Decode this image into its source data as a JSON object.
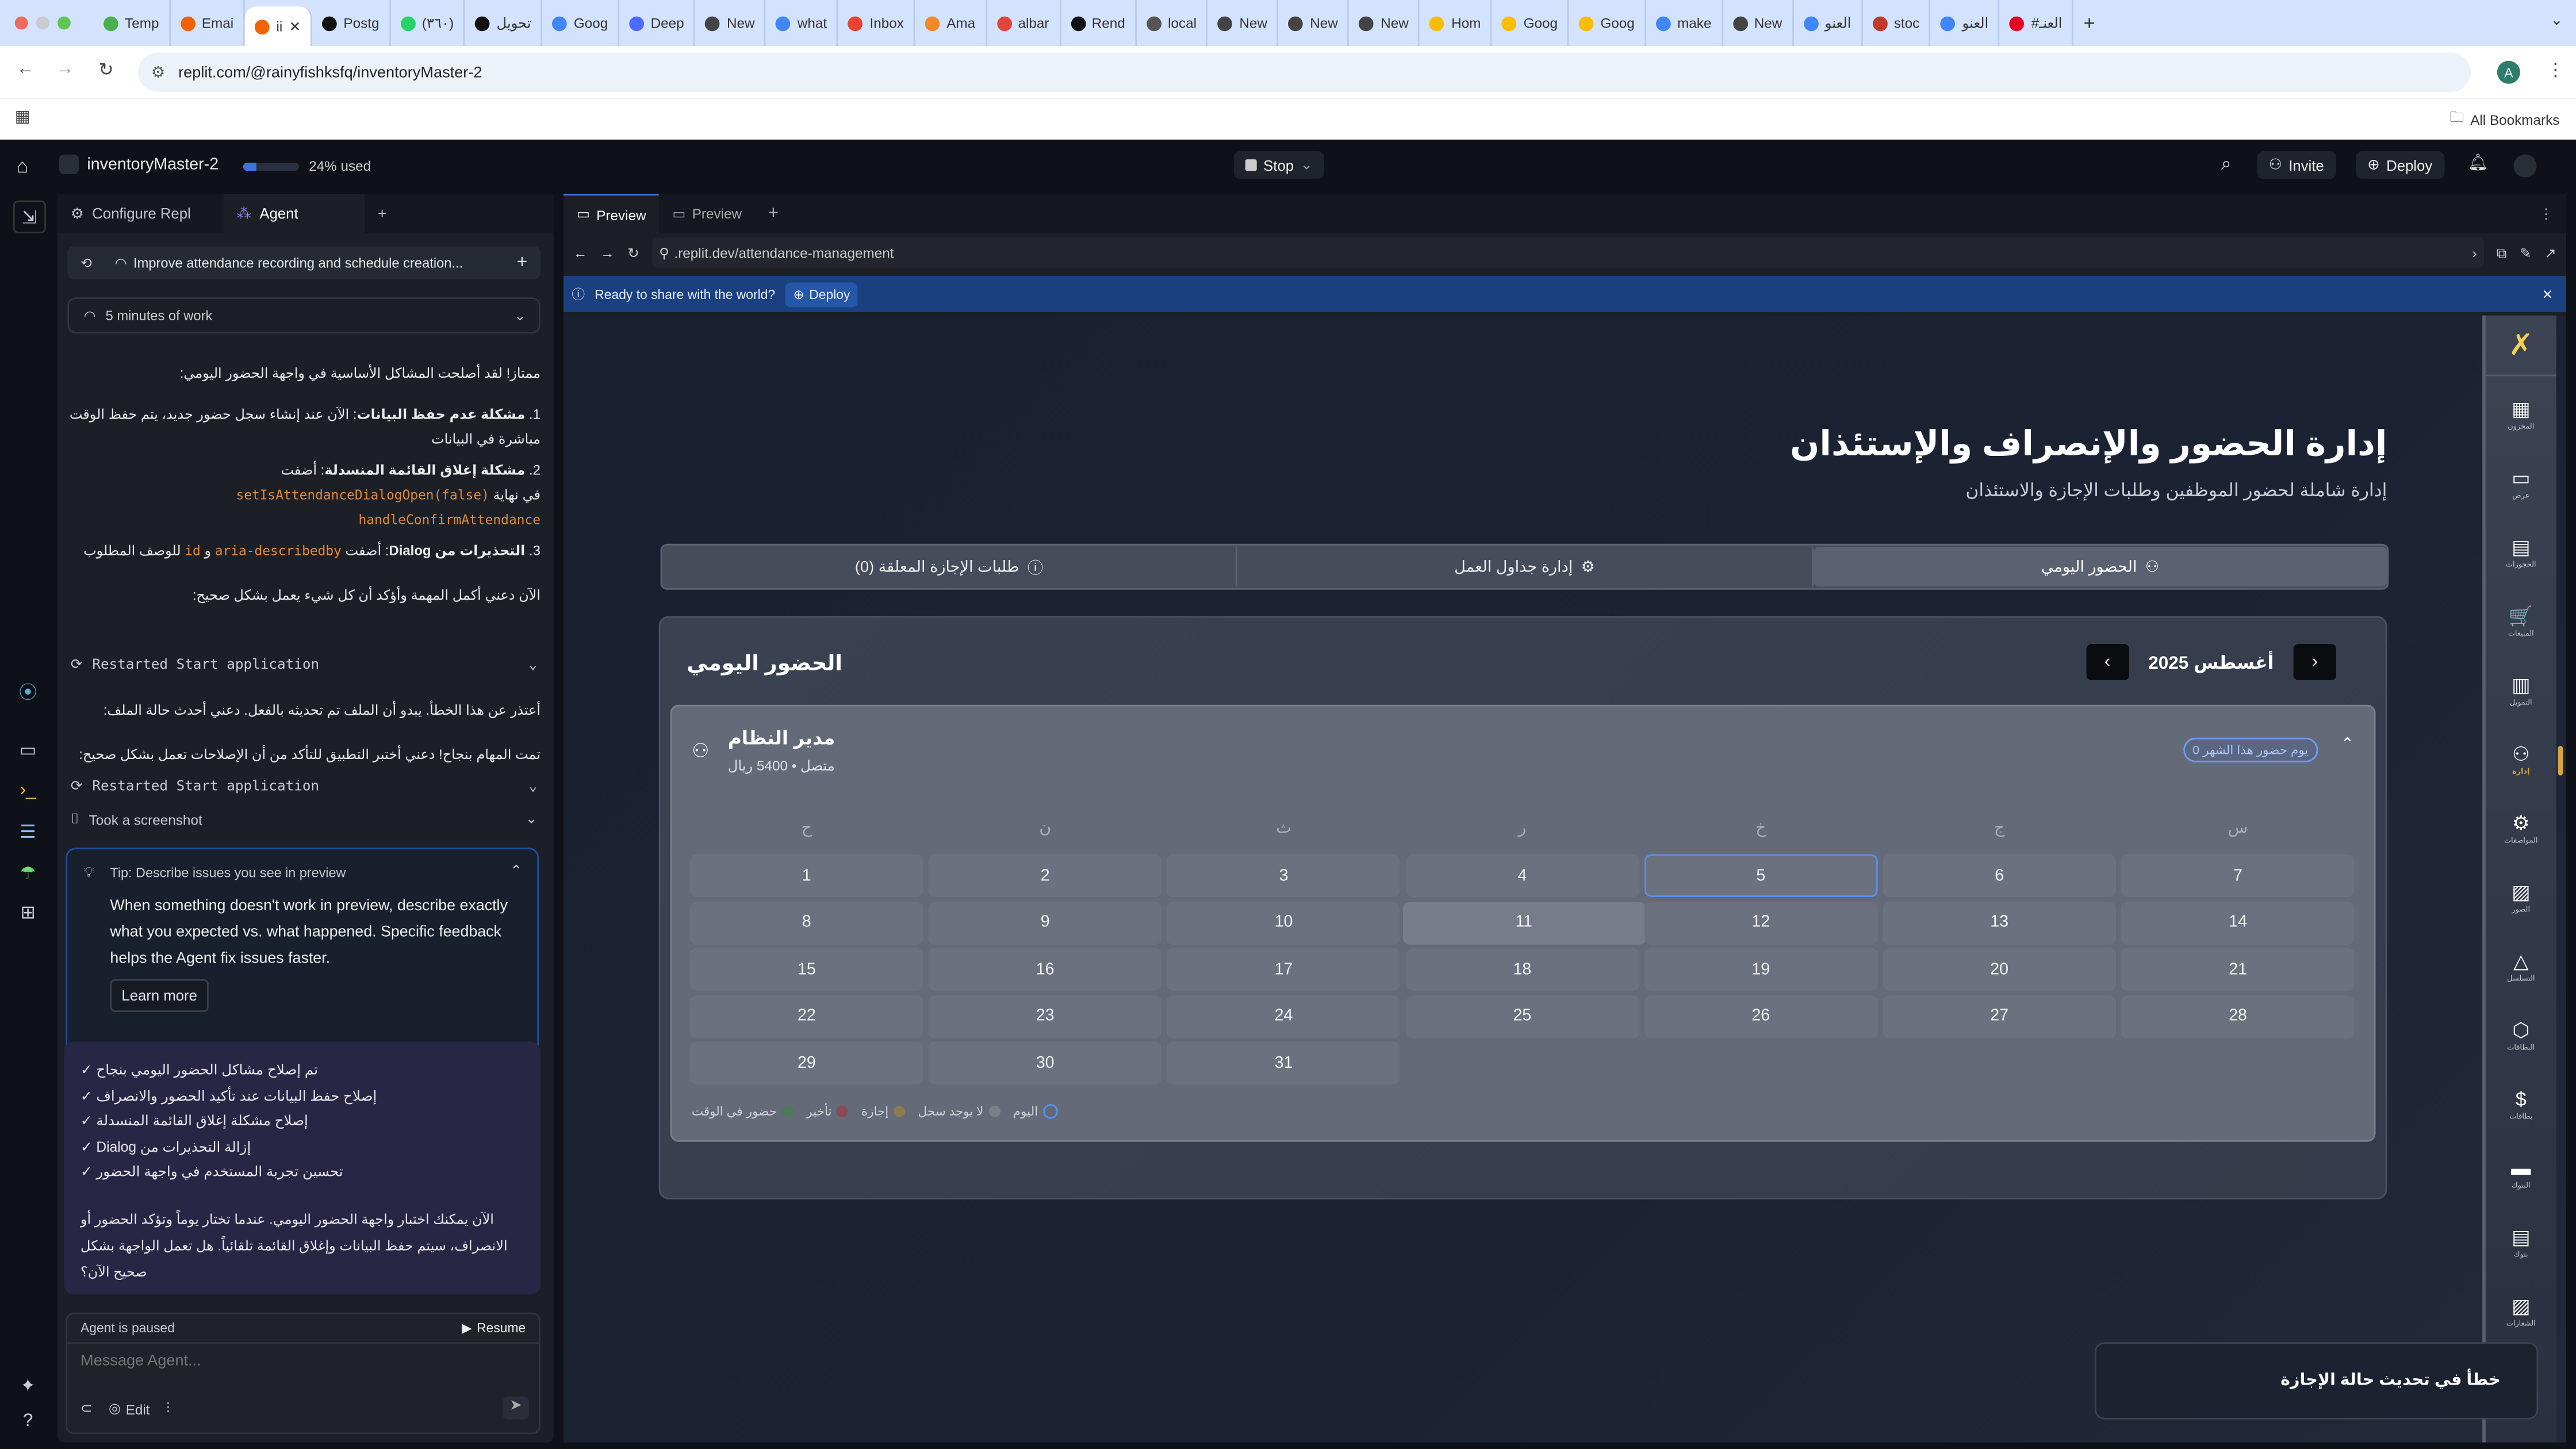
{
  "browser": {
    "tabs": [
      "Temp",
      "Emai",
      "ii",
      "Postg",
      "(٣٦٠)",
      "تحويل",
      "Goog",
      "Deep",
      "New",
      "what",
      "Inbox",
      "Ama",
      "albar",
      "Rend",
      "local",
      "New",
      "New",
      "New",
      "Hom",
      "Goog",
      "Goog",
      "make",
      "New",
      "العنو",
      "stoc",
      "العنو",
      "#العنـ"
    ],
    "tab_colors": [
      "#4caf50",
      "#f26207",
      "#f26207",
      "#111111",
      "#25d366",
      "#111111",
      "#4285f4",
      "#4d6bfe",
      "#444444",
      "#4285f4",
      "#ea4335",
      "#f08a24",
      "#e2453c",
      "#111111",
      "#555555",
      "#444444",
      "#444444",
      "#444444",
      "#fbbc04",
      "#fbbc04",
      "#fbbc04",
      "#4285f4",
      "#444444",
      "#4285f4",
      "#c0392b",
      "#4285f4",
      "#e60023"
    ],
    "active_tab_index": 2,
    "url": "replit.com/@rainyfishksfq/inventoryMaster-2",
    "bookmarks_label": "All Bookmarks",
    "profile_initial": "A"
  },
  "replit": {
    "project_name": "inventoryMaster-2",
    "usage_label": "24% used",
    "usage_percent": 24,
    "stop_label": "Stop",
    "invite_label": "Invite",
    "deploy_label": "Deploy",
    "left_tabs": [
      "Configure Repl",
      "Agent"
    ],
    "thread_title": "Improve attendance recording and schedule creation...",
    "work_summary": "5 minutes of work",
    "messages": {
      "intro": "ممتاز! لقد أصلحت المشاكل الأساسية في واجهة الحضور اليومي:",
      "item1_bold": "مشكلة عدم حفظ البيانات",
      "item1_text": ": الآن عند إنشاء سجل حضور جديد، يتم حفظ الوقت مباشرة في البيانات",
      "item2_bold": "مشكلة إغلاق القائمة المنسدلة",
      "item2_text": ": أضفت",
      "item2_code1": "setIsAttendanceDialogOpen(false)",
      "item2_mid": "في نهاية",
      "item2_code2": "handleConfirmAttendance",
      "item3_bold": "التحذيرات من Dialog",
      "item3_text": ": أضفت",
      "item3_code1": "aria-describedby",
      "item3_and": "و",
      "item3_code2": "id",
      "item3_tail": "للوصف المطلوب",
      "next": "الآن دعني أكمل المهمة وأؤكد أن كل شيء يعمل بشكل صحيح:",
      "tool1": "Restarted Start application",
      "apology": "أعتذر عن هذا الخطأ. يبدو أن الملف تم تحديثه بالفعل. دعني أحدث حالة الملف:",
      "done": "تمت المهام بنجاح! دعني أختبر التطبيق للتأكد من أن الإصلاحات تعمل بشكل صحيح:",
      "tool2": "Restarted Start application",
      "tool3": "Took a screenshot"
    },
    "tip": {
      "title": "Tip: Describe issues you see in preview",
      "body": "When something doesn't work in preview, describe exactly what you expected vs. what happened. Specific feedback helps the Agent fix issues faster.",
      "button": "Learn more"
    },
    "summary": {
      "checks": [
        "تم إصلاح مشاكل الحضور اليومي بنجاح",
        "إصلاح حفظ البيانات عند تأكيد الحضور والانصراف",
        "إصلاح مشكلة إغلاق القائمة المنسدلة",
        "إزالة التحذيرات من Dialog",
        "تحسين تجربة المستخدم في واجهة الحضور"
      ],
      "check_mark": "✓",
      "closing": "الآن يمكنك اختبار واجهة الحضور اليومي. عندما تختار يوماً وتؤكد الحضور أو الانصراف، سيتم حفظ البيانات وإغلاق القائمة تلقائياً. هل تعمل الواجهة بشكل صحيح الآن؟"
    },
    "composer": {
      "status": "Agent is paused",
      "resume": "Resume",
      "placeholder": "Message Agent...",
      "edit": "Edit"
    },
    "preview_tabs": [
      "Preview",
      "Preview"
    ],
    "preview_url": ".replit.dev/attendance-management",
    "banner_text": "Ready to share with the world?",
    "banner_deploy": "Deploy"
  },
  "app": {
    "title": "إدارة الحضور والإنصراف والإستئذان",
    "subtitle": "إدارة شاملة لحضور الموظفين وطلبات الإجازة والاستئذان",
    "tabs": [
      "الحضور اليومي",
      "إدارة جداول العمل",
      "طلبات الإجازة المعلقة (0)"
    ],
    "section_title": "الحضور اليومي",
    "month_label": "أغسطس 2025",
    "employee": {
      "name": "مدير النظام",
      "meta": "متصل • 5400 ريال",
      "badge": "يوم حضور هذا الشهر 0"
    },
    "weekdays": [
      "ح",
      "ن",
      "ث",
      "ر",
      "خ",
      "ج",
      "س"
    ],
    "days": [
      1,
      2,
      3,
      4,
      5,
      6,
      7,
      8,
      9,
      10,
      11,
      12,
      13,
      14,
      15,
      16,
      17,
      18,
      19,
      20,
      21,
      22,
      23,
      24,
      25,
      26,
      27,
      28,
      29,
      30,
      31
    ],
    "today": 5,
    "hovered_day": 11,
    "legend": [
      {
        "label": "حضور في الوقت",
        "color": "#4a7a5a"
      },
      {
        "label": "تأخير",
        "color": "#8a4a55"
      },
      {
        "label": "إجازة",
        "color": "#8a7a55"
      },
      {
        "label": "لا يوجد سجل",
        "color": "#7a7f8a"
      },
      {
        "label": "اليوم",
        "color": "#5b8df0"
      }
    ],
    "sidebar": [
      {
        "label": "المخزون",
        "icon": "▦"
      },
      {
        "label": "عرض",
        "icon": "▭"
      },
      {
        "label": "الحجوزات",
        "icon": "▤"
      },
      {
        "label": "المبيعات",
        "icon": "🛒"
      },
      {
        "label": "التمويل",
        "icon": "▥"
      },
      {
        "label": "إدارة",
        "icon": "⚇"
      },
      {
        "label": "المواصفات",
        "icon": "⚙"
      },
      {
        "label": "الصور",
        "icon": "▨"
      },
      {
        "label": "التسلسل",
        "icon": "△"
      },
      {
        "label": "البطاقات",
        "icon": "⬡"
      },
      {
        "label": "بطاقات",
        "icon": "$"
      },
      {
        "label": "البنوك",
        "icon": "▬"
      },
      {
        "label": "بنوك",
        "icon": "▤"
      },
      {
        "label": "الشعارات",
        "icon": "▨"
      }
    ],
    "active_sidebar_index": 5,
    "toast": "خطأ في تحديث حالة الإجازة",
    "colors": {
      "accent": "#5b8df0",
      "gold": "#d4a640",
      "banner": "#1b4080"
    }
  }
}
